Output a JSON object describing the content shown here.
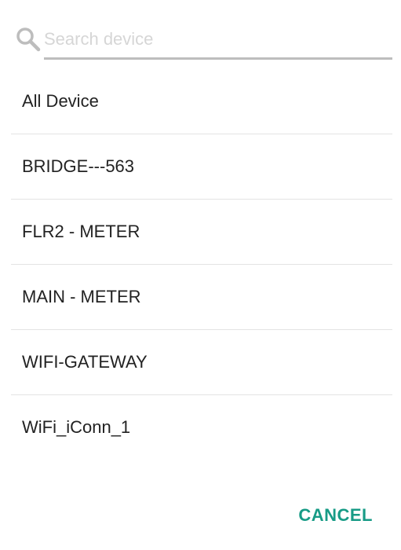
{
  "search": {
    "placeholder": "Search device",
    "value": "",
    "icon": "search-icon"
  },
  "devices": [
    {
      "label": "All Device"
    },
    {
      "label": "BRIDGE---563"
    },
    {
      "label": "FLR2 - METER"
    },
    {
      "label": "MAIN - METER"
    },
    {
      "label": "WIFI-GATEWAY"
    },
    {
      "label": "WiFi_iConn_1"
    }
  ],
  "actions": {
    "cancel_label": "CANCEL"
  },
  "colors": {
    "accent": "#179b86",
    "placeholder": "#d6d6d6",
    "underline": "#bdbdbd",
    "divider": "#e4e4e4",
    "text": "#222222"
  }
}
